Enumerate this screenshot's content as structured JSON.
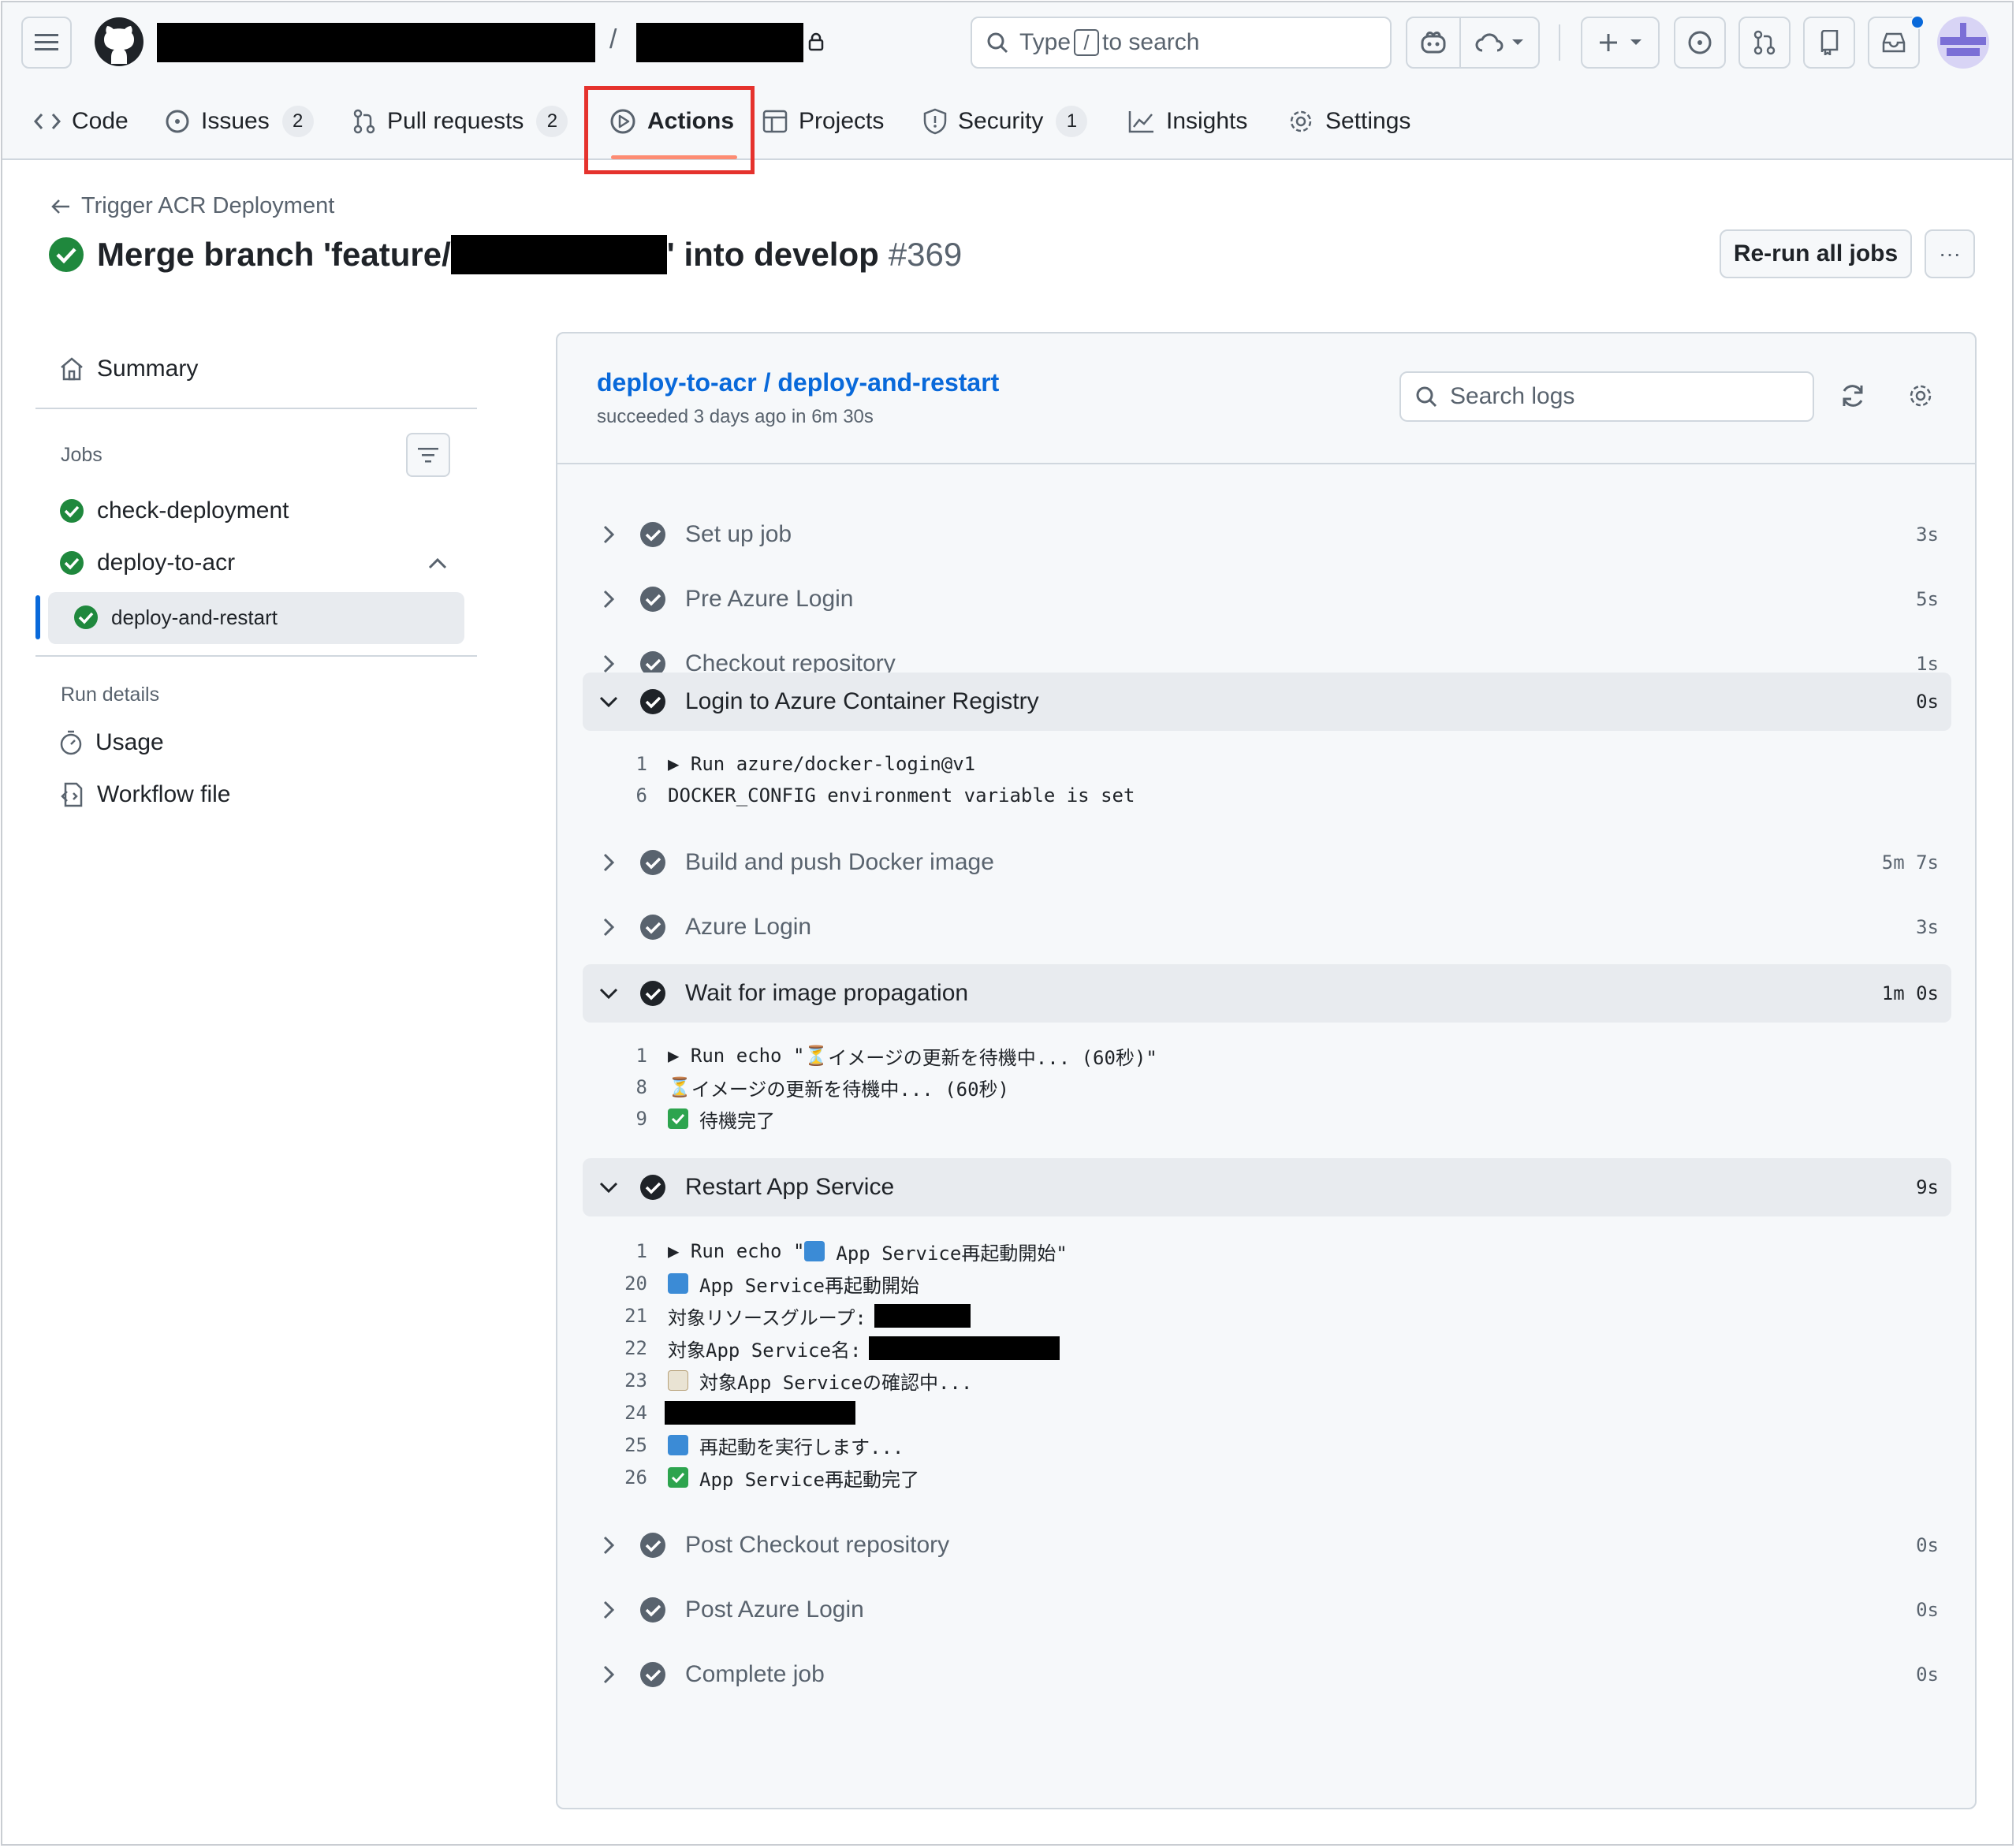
{
  "header": {
    "repo_separator": "/",
    "search_prefix": "Type",
    "search_key": "/",
    "search_suffix": "to search"
  },
  "nav_tabs": [
    {
      "label": "Code",
      "icon": "code-icon"
    },
    {
      "label": "Issues",
      "icon": "issue-icon",
      "count": "2"
    },
    {
      "label": "Pull requests",
      "icon": "pull-request-icon",
      "count": "2"
    },
    {
      "label": "Actions",
      "icon": "play-icon",
      "selected": true
    },
    {
      "label": "Projects",
      "icon": "table-icon"
    },
    {
      "label": "Security",
      "icon": "shield-icon",
      "count": "1"
    },
    {
      "label": "Insights",
      "icon": "graph-icon"
    },
    {
      "label": "Settings",
      "icon": "gear-icon"
    }
  ],
  "run": {
    "back_link": "Trigger ACR Deployment",
    "title_prefix": "Merge branch 'feature/",
    "title_suffix": "' into develop",
    "run_number": "#369",
    "rerun_label": "Re-run all jobs",
    "more_label": "···"
  },
  "sidebar": {
    "summary": "Summary",
    "jobs_heading": "Jobs",
    "jobs": [
      {
        "label": "check-deployment"
      },
      {
        "label": "deploy-to-acr"
      },
      {
        "label": "deploy-and-restart",
        "selected": true
      }
    ],
    "run_details_heading": "Run details",
    "details": [
      {
        "label": "Usage",
        "icon": "stopwatch-icon"
      },
      {
        "label": "Workflow file",
        "icon": "workflow-file-icon"
      }
    ]
  },
  "job": {
    "title": "deploy-to-acr / deploy-and-restart",
    "status": "succeeded 3 days ago in 6m 30s",
    "search_placeholder": "Search logs"
  },
  "steps": [
    {
      "name": "Set up job",
      "duration": "3s"
    },
    {
      "name": "Pre Azure Login",
      "duration": "5s"
    },
    {
      "name": "Checkout repository",
      "duration": "1s"
    },
    {
      "name": "Login to Azure Container Registry",
      "duration": "0s",
      "expanded": true,
      "log": [
        {
          "n": "1",
          "text": "▶ Run azure/docker-login@v1"
        },
        {
          "n": "6",
          "text": "DOCKER_CONFIG environment variable is set"
        }
      ]
    },
    {
      "name": "Build and push Docker image",
      "duration": "5m 7s"
    },
    {
      "name": "Azure Login",
      "duration": "3s"
    },
    {
      "name": "Wait for image propagation",
      "duration": "1m 0s",
      "expanded": true,
      "log": [
        {
          "n": "1",
          "pre": "▶ Run echo \"",
          "glyph": "⏳",
          "text": " イメージの更新を待機中... (60秒)\""
        },
        {
          "n": "8",
          "glyph": "⏳",
          "text": " イメージの更新を待機中... (60秒)"
        },
        {
          "n": "9",
          "text": "待機完了"
        }
      ]
    },
    {
      "name": "Restart App Service",
      "duration": "9s",
      "expanded": true,
      "log": [
        {
          "n": "1",
          "pre": "▶ Run echo \"",
          "text": "App Service再起動開始\""
        },
        {
          "n": "20",
          "text": "App Service再起動開始"
        },
        {
          "n": "21",
          "text": "対象リソースグループ:"
        },
        {
          "n": "22",
          "text": "対象App Service名:"
        },
        {
          "n": "23",
          "text": "対象App Serviceの確認中..."
        },
        {
          "n": "24",
          "text": ""
        },
        {
          "n": "25",
          "text": "再起動を実行します..."
        },
        {
          "n": "26",
          "text": "App Service再起動完了"
        }
      ]
    },
    {
      "name": "Post Checkout repository",
      "duration": "0s"
    },
    {
      "name": "Post Azure Login",
      "duration": "0s"
    },
    {
      "name": "Complete job",
      "duration": "0s"
    }
  ],
  "colors": {
    "success": "#1f883d",
    "link": "#0969da",
    "highlight": "#e5322d",
    "selected_underline": "#fd8c73"
  }
}
